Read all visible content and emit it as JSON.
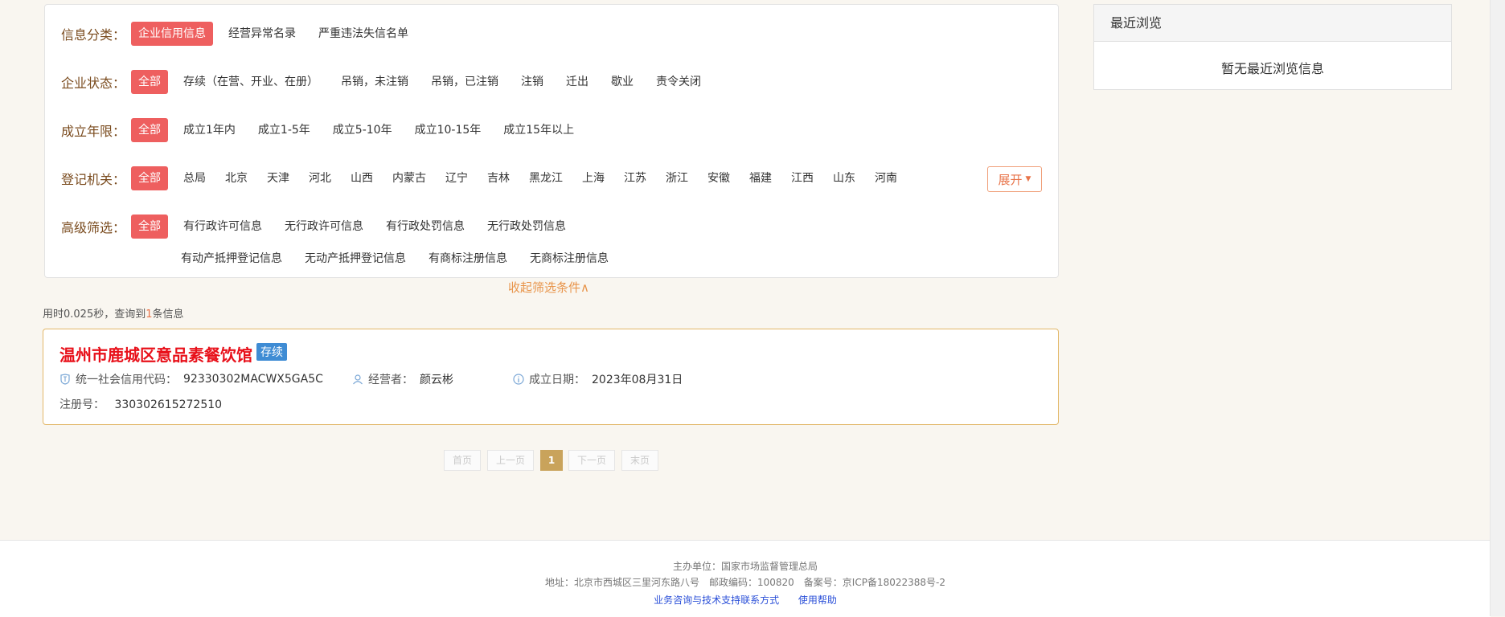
{
  "filters": {
    "category": {
      "label": "信息分类：",
      "options": [
        "企业信用信息",
        "经营异常名录",
        "严重违法失信名单"
      ]
    },
    "status": {
      "label": "企业状态：",
      "options": [
        "全部",
        "存续（在营、开业、在册）",
        "吊销，未注销",
        "吊销，已注销",
        "注销",
        "迁出",
        "歇业",
        "责令关闭"
      ]
    },
    "years": {
      "label": "成立年限：",
      "options": [
        "全部",
        "成立1年内",
        "成立1-5年",
        "成立5-10年",
        "成立10-15年",
        "成立15年以上"
      ]
    },
    "authority": {
      "label": "登记机关：",
      "options": [
        "全部",
        "总局",
        "北京",
        "天津",
        "河北",
        "山西",
        "内蒙古",
        "辽宁",
        "吉林",
        "黑龙江",
        "上海",
        "江苏",
        "浙江",
        "安徽",
        "福建",
        "江西",
        "山东",
        "河南"
      ],
      "expand_label": "展开"
    },
    "advanced": {
      "label": "高级筛选：",
      "options": [
        "全部",
        "有行政许可信息",
        "无行政许可信息",
        "有行政处罚信息",
        "无行政处罚信息"
      ],
      "options_row2": [
        "有动产抵押登记信息",
        "无动产抵押登记信息",
        "有商标注册信息",
        "无商标注册信息"
      ]
    },
    "collapse_label": "收起筛选条件∧"
  },
  "query": {
    "prefix": "用时0.025秒，查询到",
    "count": "1",
    "suffix": "条信息"
  },
  "result": {
    "name": "温州市鹿城区意品素餐饮馆",
    "status": "存续",
    "credit_code_label": "统一社会信用代码：",
    "credit_code": "92330302MACWX5GA5C",
    "operator_label": "经营者：",
    "operator": "颜云彬",
    "date_label": "成立日期：",
    "date": "2023年08月31日",
    "reg_label": "注册号：",
    "reg_no": "330302615272510"
  },
  "pagination": {
    "first": "首页",
    "prev": "上一页",
    "current": "1",
    "next": "下一页",
    "last": "末页"
  },
  "recent": {
    "title": "最近浏览",
    "empty": "暂无最近浏览信息"
  },
  "footer": {
    "sponsor": "主办单位：国家市场监督管理总局",
    "address": "地址：北京市西城区三里河东路八号　邮政编码：100820　备案号：京ICP备18022388号-2",
    "link_support": "业务咨询与技术支持联系方式",
    "link_help": "使用帮助"
  },
  "colors": {
    "accent_red": "#ee5f5f",
    "company_red": "#e8101a",
    "status_blue": "#3f8cd4",
    "card_border": "#e2b768",
    "pager_active": "#c9a35b"
  }
}
